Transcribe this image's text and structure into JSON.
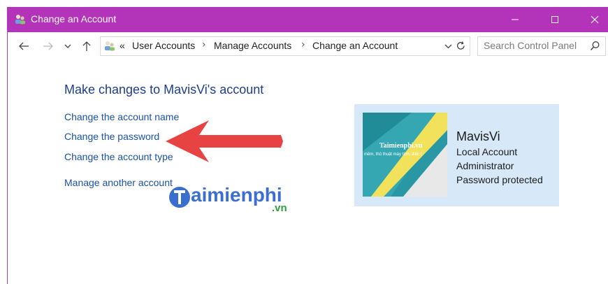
{
  "window": {
    "title": "Change an Account"
  },
  "address": {
    "crumbs": [
      "«",
      "User Accounts",
      "Manage Accounts",
      "Change an Account"
    ],
    "search_placeholder": "Search Control Panel"
  },
  "main": {
    "heading": "Make changes to MavisVi's account",
    "links": [
      "Change the account name",
      "Change the password",
      "Change the account type",
      "Manage another account"
    ]
  },
  "account_card": {
    "name": "MavisVi",
    "type": "Local Account",
    "role": "Administrator",
    "status": "Password protected",
    "picture_text": "Taimienphi.vn",
    "picture_subtext": "mềm, thủ thuật máy tính, điện t"
  },
  "watermark": {
    "text": "aimienphi",
    "tld": ".vn"
  },
  "colors": {
    "titlebar": "#b333b9",
    "link": "#1b52a5",
    "heading": "#1e3d8f",
    "card": "#d7e9f9",
    "arrow": "#e84343"
  },
  "icons": [
    "users-icon",
    "minimize-icon",
    "maximize-icon",
    "close-icon",
    "back-arrow-icon",
    "forward-arrow-icon",
    "recent-dropdown-icon",
    "up-arrow-icon",
    "control-panel-icon",
    "address-dropdown-icon",
    "refresh-icon",
    "search-icon",
    "red-arrow-annotation"
  ]
}
